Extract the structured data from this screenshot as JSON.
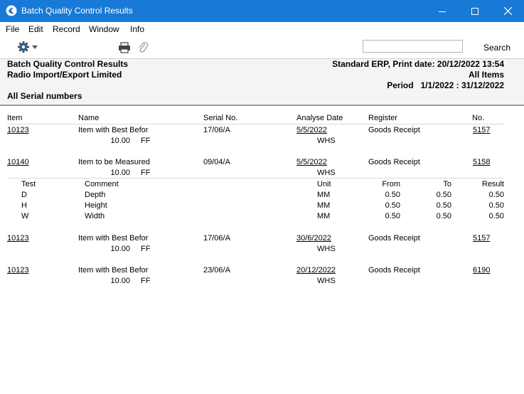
{
  "window": {
    "title": "Batch Quality Control Results"
  },
  "menu": {
    "items": [
      "File",
      "Edit",
      "Record",
      "Window",
      "Info"
    ]
  },
  "toolbar": {
    "search_value": "",
    "search_label": "Search"
  },
  "header": {
    "title": "Batch Quality Control Results",
    "company": "Radio Import/Export Limited",
    "selection": "All Serial numbers",
    "print_info": "Standard ERP, Print date: 20/12/2022 13:54",
    "items_scope": "All Items",
    "period": "Period   1/1/2022 : 31/12/2022"
  },
  "columns": {
    "item": "Item",
    "name": "Name",
    "serial": "Serial No.",
    "date": "Analyse Date",
    "register": "Register",
    "no": "No."
  },
  "test_columns": {
    "test": "Test",
    "comment": "Comment",
    "unit": "Unit",
    "from": "From",
    "to": "To",
    "result": "Result"
  },
  "records": [
    {
      "item": "10123",
      "name": "Item with Best Befor",
      "serial": "17/06/A",
      "date": "5/5/2022",
      "register": "Goods Receipt",
      "no": "5157",
      "qty": "10.00",
      "unit": "FF",
      "location": "WHS"
    },
    {
      "item": "10140",
      "name": "Item to be Measured",
      "serial": "09/04/A",
      "date": "5/5/2022",
      "register": "Goods Receipt",
      "no": "5158",
      "qty": "10.00",
      "unit": "FF",
      "location": "WHS",
      "tests": [
        {
          "test": "D",
          "comment": "Depth",
          "unit": "MM",
          "from": "0.50",
          "to": "0.50",
          "result": "0.50"
        },
        {
          "test": "H",
          "comment": "Height",
          "unit": "MM",
          "from": "0.50",
          "to": "0.50",
          "result": "0.50"
        },
        {
          "test": "W",
          "comment": "Width",
          "unit": "MM",
          "from": "0.50",
          "to": "0.50",
          "result": "0.50"
        }
      ]
    },
    {
      "item": "10123",
      "name": "Item with Best Befor",
      "serial": "17/06/A",
      "date": "30/6/2022",
      "register": "Goods Receipt",
      "no": "5157",
      "qty": "10.00",
      "unit": "FF",
      "location": "WHS"
    },
    {
      "item": "10123",
      "name": "Item with Best Befor",
      "serial": "23/06/A",
      "date": "20/12/2022",
      "register": "Goods Receipt",
      "no": "6190",
      "qty": "10.00",
      "unit": "FF",
      "location": "WHS"
    }
  ]
}
